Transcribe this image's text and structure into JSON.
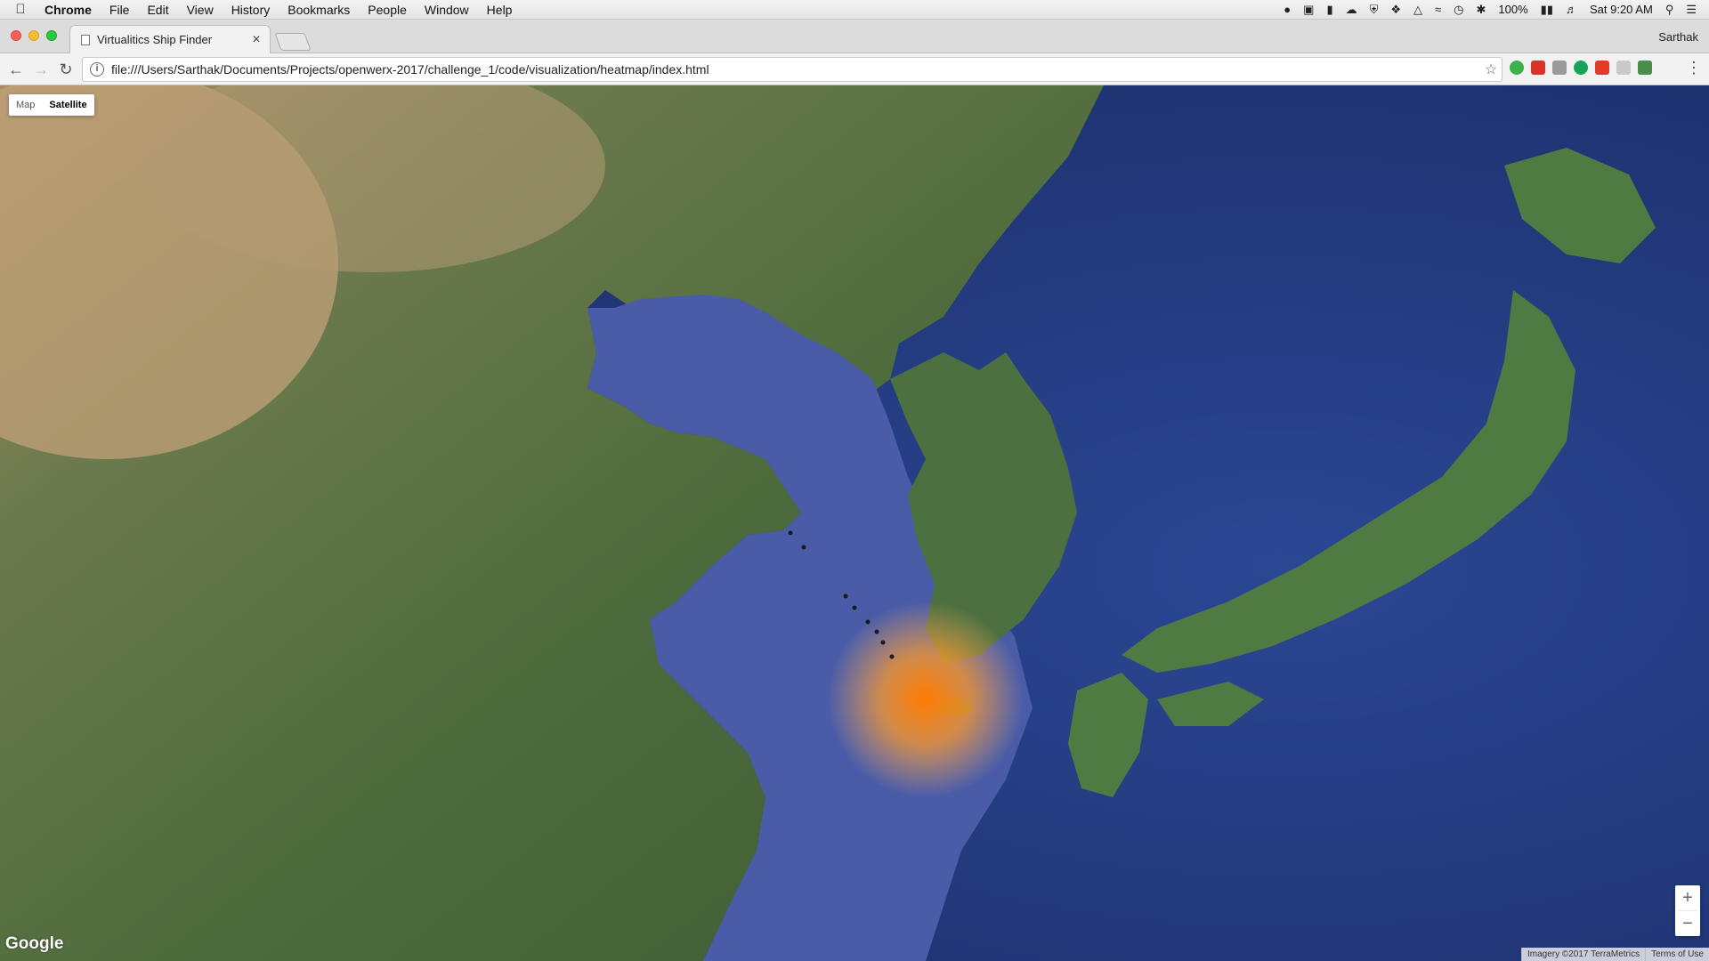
{
  "menubar": {
    "app": "Chrome",
    "items": [
      "File",
      "Edit",
      "View",
      "History",
      "Bookmarks",
      "People",
      "Window",
      "Help"
    ],
    "battery": "100%",
    "clock": "Sat 9:20 AM"
  },
  "browser": {
    "tab_title": "Virtualitics Ship Finder",
    "profile": "Sarthak",
    "url": "file:///Users/Sarthak/Documents/Projects/openwerx-2017/challenge_1/code/visualization/heatmap/index.html"
  },
  "map": {
    "map_type_options": [
      "Map",
      "Satellite"
    ],
    "selected_map_type": "Satellite",
    "logo": "Google",
    "imagery_credit": "Imagery ©2017 TerraMetrics",
    "terms": "Terms of Use",
    "zoom_in": "+",
    "zoom_out": "−",
    "colors": {
      "sea": "#3a4f9a",
      "land": "#4d6a3c",
      "desert": "#b79a72",
      "heat": "#ff8a00"
    }
  }
}
